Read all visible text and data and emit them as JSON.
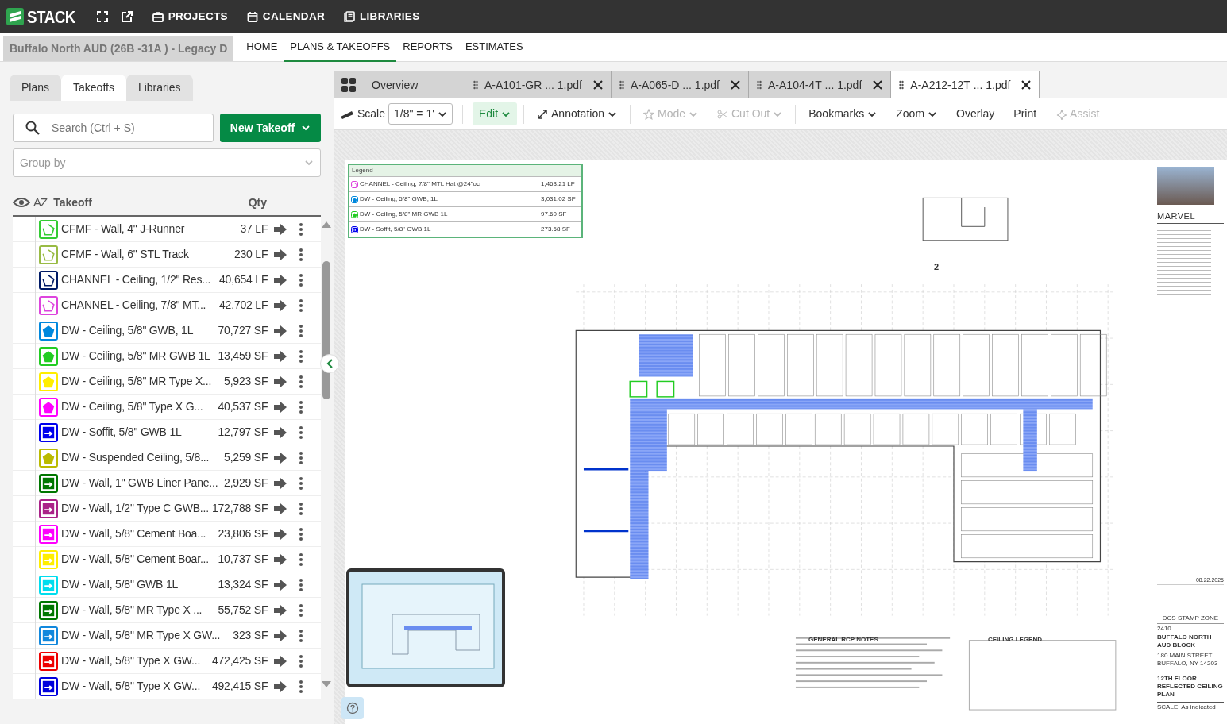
{
  "app": {
    "logo": "STACK",
    "nav": [
      "PROJECTS",
      "CALENDAR",
      "LIBRARIES"
    ]
  },
  "project_title": "Buffalo North AUD (26B -31A ) - Legacy D",
  "main_tabs": [
    {
      "label": "HOME",
      "selected": false
    },
    {
      "label": "PLANS & TAKEOFFS",
      "selected": true
    },
    {
      "label": "REPORTS",
      "selected": false
    },
    {
      "label": "ESTIMATES",
      "selected": false
    }
  ],
  "panel_tabs": [
    {
      "label": "Plans",
      "selected": false
    },
    {
      "label": "Takeoffs",
      "selected": true
    },
    {
      "label": "Libraries",
      "selected": false
    }
  ],
  "search": {
    "placeholder": "Search (Ctrl + S)"
  },
  "new_button": "New Takeoff",
  "group_by": {
    "placeholder": "Group by"
  },
  "list_header": {
    "sort": "AZ",
    "name": "Takeoff",
    "qty": "Qty"
  },
  "takeoffs": [
    {
      "name": "CFMF - Wall, 4\" J-Runner",
      "qty": "37 LF",
      "kind": "linear",
      "color": "#33cc33"
    },
    {
      "name": "CFMF - Wall, 6\" STL Track",
      "qty": "230 LF",
      "kind": "linear",
      "color": "#99bb44"
    },
    {
      "name": "CHANNEL - Ceiling, 1/2\" Res...",
      "qty": "40,654 LF",
      "kind": "linear",
      "color": "#001a66"
    },
    {
      "name": "CHANNEL - Ceiling, 7/8\" MT...",
      "qty": "42,702 LF",
      "kind": "linear",
      "color": "#dd44dd"
    },
    {
      "name": "DW - Ceiling, 5/8\" GWB, 1L",
      "qty": "70,727 SF",
      "kind": "area",
      "color": "#0088dd"
    },
    {
      "name": "DW - Ceiling, 5/8\" MR GWB 1L",
      "qty": "13,459 SF",
      "kind": "area",
      "color": "#22cc22"
    },
    {
      "name": "DW - Ceiling, 5/8\" MR Type X...",
      "qty": "5,923 SF",
      "kind": "area",
      "color": "#ffee00"
    },
    {
      "name": "DW - Ceiling, 5/8\" Type X G...",
      "qty": "40,537 SF",
      "kind": "area",
      "color": "#ff00ff"
    },
    {
      "name": "DW - Soffit, 5/8\" GWB 1L",
      "qty": "12,797 SF",
      "kind": "wall",
      "color": "#0000ee"
    },
    {
      "name": "DW - Suspended Ceiling, 5/8...",
      "qty": "5,259 SF",
      "kind": "area",
      "color": "#bbbb00"
    },
    {
      "name": "DW - Wall, 1\" GWB Liner Pane...",
      "qty": "2,929 SF",
      "kind": "wall",
      "color": "#007700"
    },
    {
      "name": "DW - Wall, 1/2\" Type C GWB...",
      "qty": "172,788 SF",
      "kind": "wall",
      "color": "#aa2288"
    },
    {
      "name": "DW - Wall, 5/8\" Cement Boa...",
      "qty": "23,806 SF",
      "kind": "wall",
      "color": "#ff00ff"
    },
    {
      "name": "DW - Wall, 5/8\" Cement Boar...",
      "qty": "10,737 SF",
      "kind": "wall",
      "color": "#ffee00"
    },
    {
      "name": "DW - Wall, 5/8\" GWB 1L",
      "qty": "13,324 SF",
      "kind": "wall",
      "color": "#00ddee"
    },
    {
      "name": "DW - Wall, 5/8\" MR Type X ...",
      "qty": "55,752 SF",
      "kind": "wall",
      "color": "#007701"
    },
    {
      "name": "DW - Wall, 5/8\" MR Type X GW...",
      "qty": "323 SF",
      "kind": "wall",
      "color": "#1188dd"
    },
    {
      "name": "DW - Wall, 5/8\" Type X GW...",
      "qty": "472,425 SF",
      "kind": "wall",
      "color": "#ee0000"
    },
    {
      "name": "DW - Wall, 5/8\" Type X GW...",
      "qty": "492,415 SF",
      "kind": "wall",
      "color": "#0000dd"
    }
  ],
  "sheet_tabs": [
    {
      "label": "Overview",
      "kind": "overview",
      "selected": false
    },
    {
      "label": "A-A101-GR ... 1.pdf",
      "kind": "file",
      "selected": false
    },
    {
      "label": "A-A065-D ... 1.pdf",
      "kind": "file",
      "selected": false
    },
    {
      "label": "A-A104-4T ... 1.pdf",
      "kind": "file",
      "selected": false
    },
    {
      "label": "A-A212-12T ... 1.pdf",
      "kind": "file",
      "selected": true
    }
  ],
  "toolbar": {
    "scale_label": "Scale",
    "scale_value": "1/8\" = 1'",
    "items": [
      {
        "label": "Edit",
        "active": true,
        "disabled": false,
        "dropdown": true
      },
      {
        "label": "Annotation",
        "active": false,
        "disabled": false,
        "dropdown": true
      },
      {
        "label": "Mode",
        "active": false,
        "disabled": true,
        "dropdown": true
      },
      {
        "label": "Cut Out",
        "active": false,
        "disabled": true,
        "dropdown": true
      },
      {
        "label": "Bookmarks",
        "active": false,
        "disabled": false,
        "dropdown": true
      },
      {
        "label": "Zoom",
        "active": false,
        "disabled": false,
        "dropdown": true
      },
      {
        "label": "Overlay",
        "active": false,
        "disabled": false,
        "dropdown": false
      },
      {
        "label": "Print",
        "active": false,
        "disabled": false,
        "dropdown": false
      },
      {
        "label": "Assist",
        "active": false,
        "disabled": true,
        "dropdown": false
      }
    ]
  },
  "legend": {
    "title": "Legend",
    "rows": [
      {
        "name": "CHANNEL - Ceiling, 7/8\" MTL Hat @24\"oc",
        "qty": "1,463.21 LF",
        "kind": "linear",
        "color": "#dd44dd"
      },
      {
        "name": "DW - Ceiling, 5/8\" GWB, 1L",
        "qty": "3,031.02 SF",
        "kind": "area",
        "color": "#0088dd"
      },
      {
        "name": "DW - Ceiling, 5/8\" MR GWB 1L",
        "qty": "97.60 SF",
        "kind": "area",
        "color": "#22cc22"
      },
      {
        "name": "DW - Soffit, 5/8\" GWB 1L",
        "qty": "273.68 SF",
        "kind": "wall",
        "color": "#0000ee"
      }
    ]
  },
  "sheet": {
    "plan_number": "2",
    "notes_headings": [
      "GENERAL RCP NOTES",
      "CEILING LEGEND"
    ],
    "title_block": {
      "firm": "MARVEL",
      "date": "08.22.2025",
      "stamp": "DCS STAMP ZONE",
      "project_number": "2410",
      "project_name": "BUFFALO NORTH AUD BLOCK",
      "address": [
        "180 MAIN STREET",
        "BUFFALO, NY 14203"
      ],
      "sheet_title": "12TH FLOOR REFLECTED CEILING PLAN",
      "scale": "SCALE: As indicated"
    }
  }
}
